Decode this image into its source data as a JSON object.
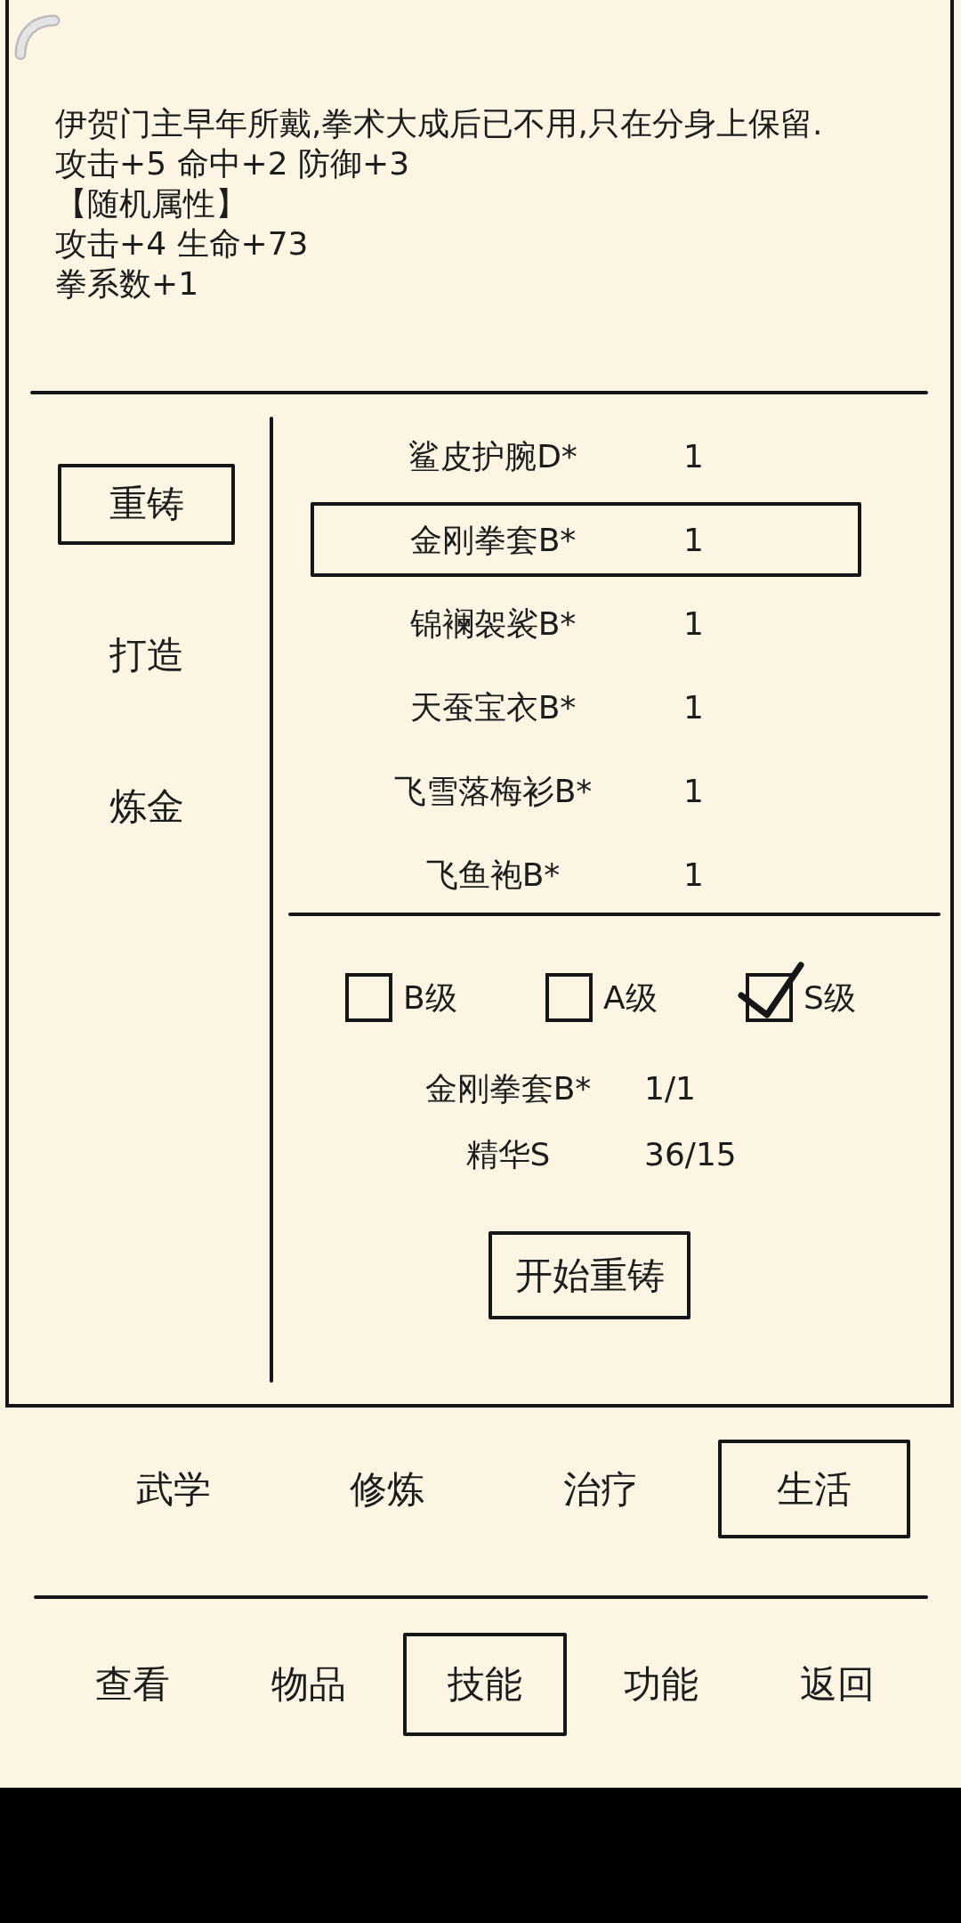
{
  "description": {
    "lines": [
      "伊贺门主早年所戴,拳术大成后已不用,只在分身上保留.",
      "攻击+5 命中+2 防御+3",
      "【随机属性】",
      "攻击+4 生命+73",
      "拳系数+1"
    ]
  },
  "side_menu": [
    {
      "label": "重铸",
      "selected": true
    },
    {
      "label": "打造",
      "selected": false
    },
    {
      "label": "炼金",
      "selected": false
    }
  ],
  "items": [
    {
      "name": "鲨皮护腕D*",
      "count": "1",
      "selected": false
    },
    {
      "name": "金刚拳套B*",
      "count": "1",
      "selected": true
    },
    {
      "name": "锦襕袈裟B*",
      "count": "1",
      "selected": false
    },
    {
      "name": "天蚕宝衣B*",
      "count": "1",
      "selected": false
    },
    {
      "name": "飞雪落梅衫B*",
      "count": "1",
      "selected": false
    },
    {
      "name": "飞鱼袍B*",
      "count": "1",
      "selected": false
    }
  ],
  "grade_filters": [
    {
      "label": "B级",
      "checked": false
    },
    {
      "label": "A级",
      "checked": false
    },
    {
      "label": "S级",
      "checked": true
    }
  ],
  "requirements": [
    {
      "name": "金刚拳套B*",
      "amount": "1/1"
    },
    {
      "name": "精华S",
      "amount": "36/15"
    }
  ],
  "action_button": {
    "label": "开始重铸"
  },
  "skill_tabs": [
    {
      "label": "武学",
      "selected": false
    },
    {
      "label": "修炼",
      "selected": false
    },
    {
      "label": "治疗",
      "selected": false
    },
    {
      "label": "生活",
      "selected": true
    }
  ],
  "bottom_nav": [
    {
      "label": "查看",
      "selected": false
    },
    {
      "label": "物品",
      "selected": false
    },
    {
      "label": "技能",
      "selected": true
    },
    {
      "label": "功能",
      "selected": false
    },
    {
      "label": "返回",
      "selected": false
    }
  ]
}
